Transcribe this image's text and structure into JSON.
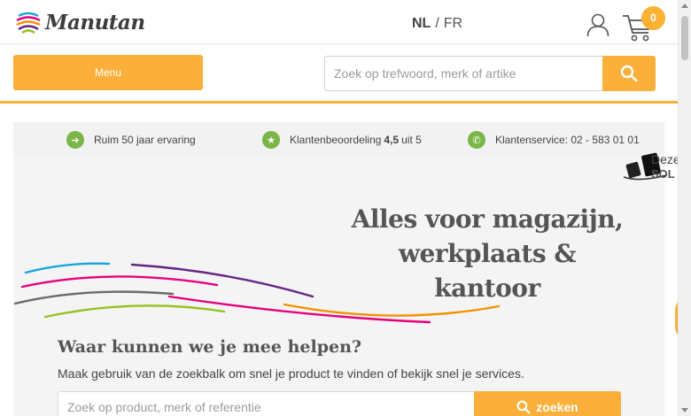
{
  "header": {
    "logo_text": "Manutan",
    "lang_active": "NL",
    "lang_separator": "/",
    "lang_other": "FR",
    "cart_count": "0"
  },
  "nav": {
    "menu_label": "Menu",
    "search_placeholder": "Zoek op trefwoord, merk of artike"
  },
  "usps": [
    {
      "text": "Ruim 50 jaar ervaring",
      "icon": "arrow-right-icon"
    },
    {
      "text_before": "Klantenbeoordeling",
      "rating": "4,5",
      "text_after": "uit 5",
      "icon": "star-icon"
    },
    {
      "text": "Klantenservice: 02 - 583 01 01",
      "icon": "phone-icon"
    }
  ],
  "floating": {
    "line1": "Deze",
    "line2": "SOL"
  },
  "hero": {
    "title_line1": "Alles voor magazijn,",
    "title_line2": "werkplaats & kantoor",
    "help_title": "Waar kunnen we je mee helpen?",
    "help_subtitle": "Maak gebruik van de zoekbalk om snel je product te vinden of bekijk snel je services.",
    "search_placeholder": "Zoek op product, merk of referentie",
    "search_button": "zoeken"
  },
  "colors": {
    "accent": "#fbb03b",
    "usp_green": "#7ab648",
    "hero_bg": "#f4f4f4"
  }
}
